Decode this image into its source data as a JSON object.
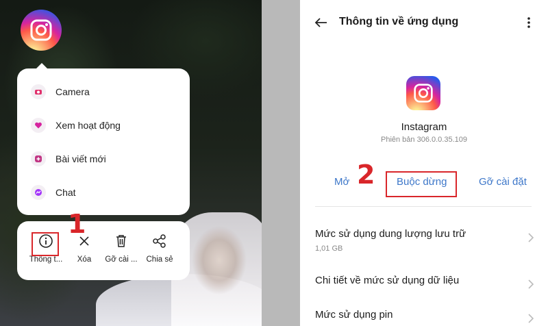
{
  "left": {
    "menu_items": [
      {
        "label": "Camera",
        "icon": "camera-icon"
      },
      {
        "label": "Xem hoạt động",
        "icon": "heart-icon"
      },
      {
        "label": "Bài viết mới",
        "icon": "plus-icon"
      },
      {
        "label": "Chat",
        "icon": "messenger-icon"
      }
    ],
    "actions": [
      {
        "label": "Thông t...",
        "icon": "info-icon"
      },
      {
        "label": "Xóa",
        "icon": "close-icon"
      },
      {
        "label": "Gỡ cài ...",
        "icon": "trash-icon"
      },
      {
        "label": "Chia sẻ",
        "icon": "share-icon"
      }
    ],
    "step_marker": "1"
  },
  "right": {
    "title": "Thông tin về ứng dụng",
    "app_name": "Instagram",
    "version": "Phiên bản 306.0.0.35.109",
    "buttons": {
      "open": "Mở",
      "force_stop": "Buộc dừng",
      "uninstall": "Gỡ cài đặt"
    },
    "step_marker": "2",
    "rows": [
      {
        "title": "Mức sử dụng dung lượng lưu trữ",
        "sub": "1,01 GB"
      },
      {
        "title": "Chi tiết về mức sử dụng dữ liệu",
        "sub": ""
      },
      {
        "title": "Mức sử dụng pin",
        "sub": ""
      }
    ]
  },
  "colors": {
    "accent_blue": "#3d77c9",
    "highlight_red": "#d9262a"
  }
}
